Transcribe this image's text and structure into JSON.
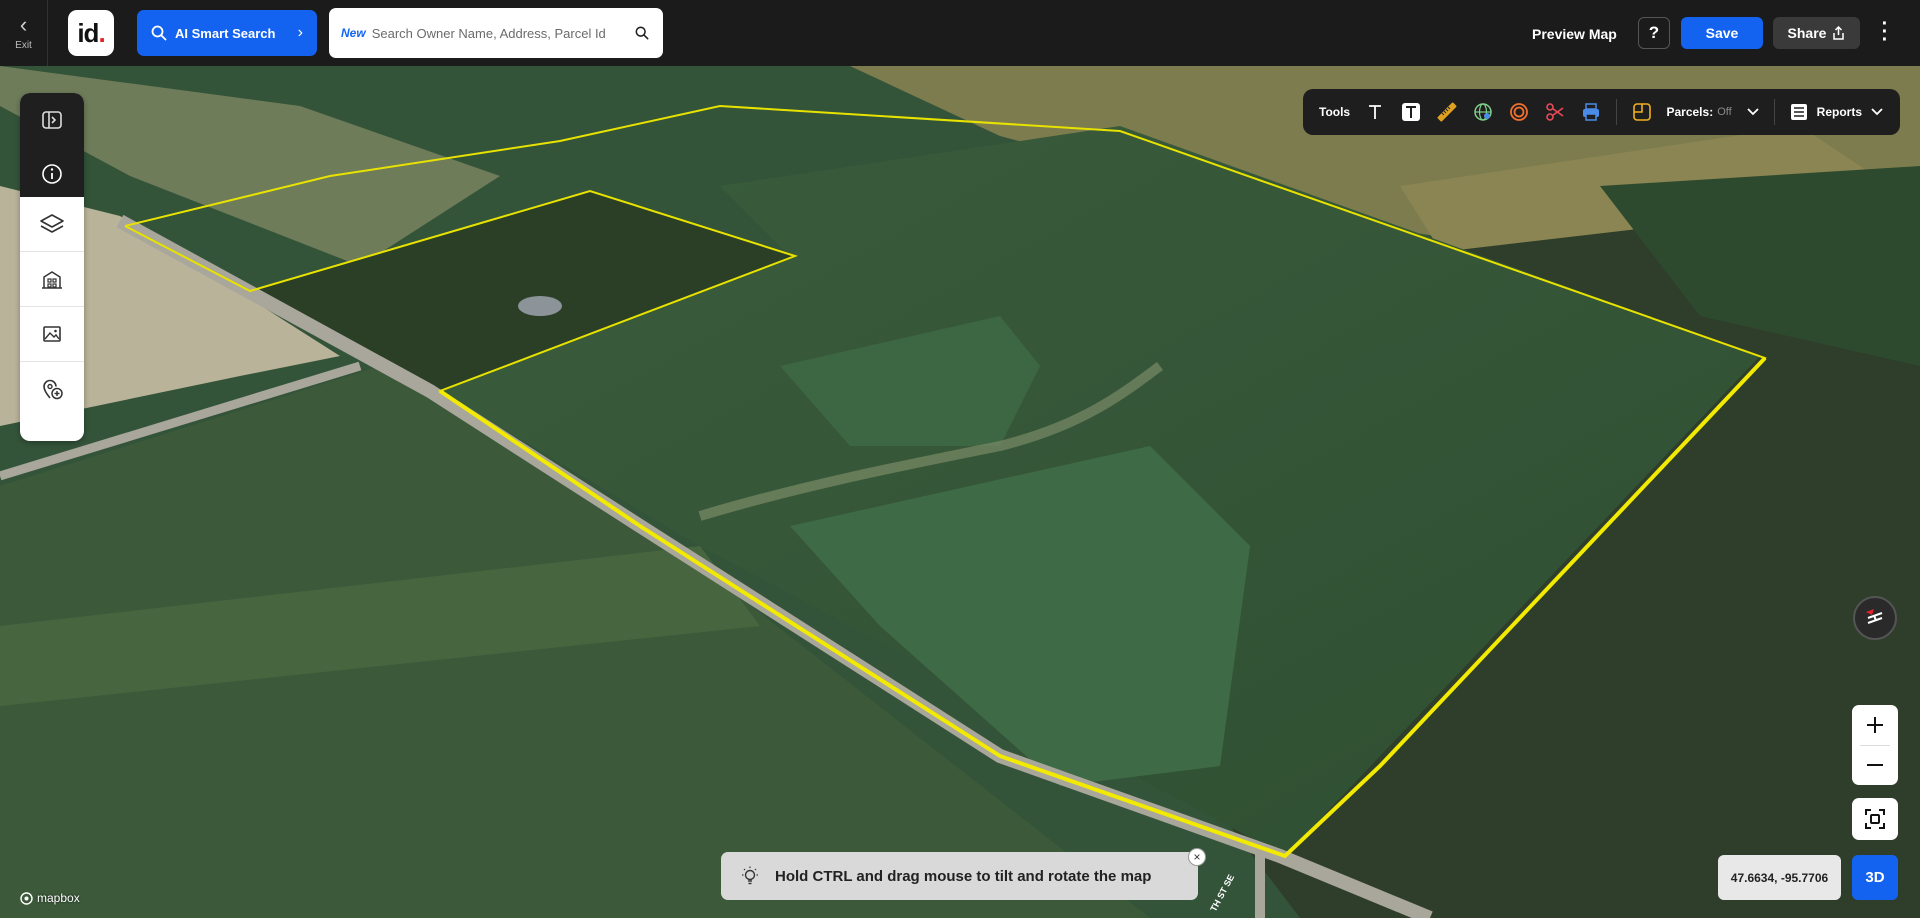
{
  "header": {
    "exit_label": "Exit",
    "logo_text": "id",
    "logo_dot": ".",
    "ai_search_label": "AI Smart Search",
    "search_badge": "New",
    "search_placeholder": "Search Owner Name, Address, Parcel Id",
    "preview_map_label": "Preview Map",
    "help_label": "?",
    "save_label": "Save",
    "share_label": "Share"
  },
  "sidebar": {
    "items": [
      {
        "icon": "panel-toggle-icon"
      },
      {
        "icon": "info-icon"
      },
      {
        "icon": "layers-icon"
      },
      {
        "icon": "buildings-icon"
      },
      {
        "icon": "image-icon"
      },
      {
        "icon": "add-location-icon"
      }
    ]
  },
  "toolbar": {
    "tools_label": "Tools",
    "parcels_label": "Parcels:",
    "parcels_state": "Off",
    "reports_label": "Reports"
  },
  "map": {
    "coordinates": "47.6634, -95.7706",
    "mode_label": "3D",
    "hint_text": "Hold CTRL and drag mouse to tilt and rotate the map",
    "attribution": "mapbox",
    "road_label": "TH ST SE",
    "colors": {
      "parcel_outline": "#e8e200",
      "accent": "#1463f0"
    }
  }
}
